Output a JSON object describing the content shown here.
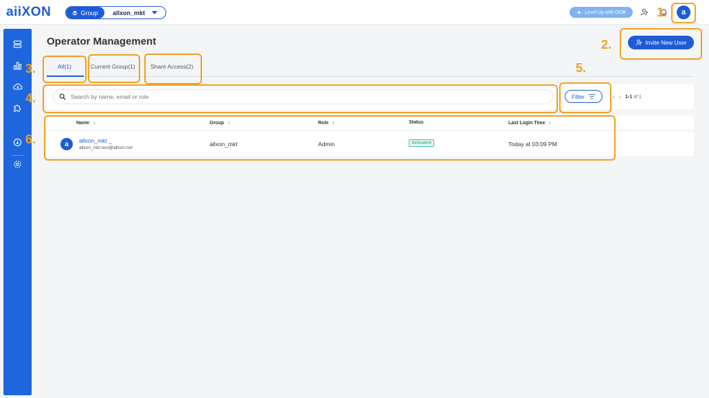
{
  "header": {
    "logo_text": "aiiXON",
    "group_label": "Group",
    "group_name": "allxon_mkt",
    "level_up_label": "Level Up with OOB",
    "avatar_letter": "a"
  },
  "sidebar": {
    "items": [
      {
        "icon": "server-icon"
      },
      {
        "icon": "bar-chart-icon"
      },
      {
        "icon": "cloud-upload-icon"
      },
      {
        "icon": "puzzle-icon"
      },
      {
        "icon": "download-circle-icon"
      },
      {
        "icon": "gear-icon"
      }
    ]
  },
  "page": {
    "title": "Operator Management",
    "invite_label": "Invite New User"
  },
  "tabs": [
    {
      "label": "All(1)",
      "active": true
    },
    {
      "label": "Current Group(1)",
      "active": false
    },
    {
      "label": "Share Access(2)",
      "active": false
    }
  ],
  "search": {
    "placeholder": "Search by name, email or role",
    "value": ""
  },
  "filter_label": "Filter",
  "pagination": {
    "range": "1-1",
    "of_text": "of 1"
  },
  "table": {
    "columns": [
      "Name",
      "Group",
      "Role",
      "Status",
      "Last Login Time"
    ],
    "rows": [
      {
        "avatar": "a",
        "name": "allxon_mkt _",
        "email": "allxon_mkt.test@allxon.net",
        "group": "allxon_mkt",
        "role": "Admin",
        "status": "Activated",
        "last_login": "Today at 03:09 PM"
      }
    ]
  },
  "annotations": [
    "1.",
    "2.",
    "3.",
    "4.",
    "5.",
    "6."
  ],
  "colors": {
    "brand": "#1e5bd8",
    "sidebar": "#1e66dd",
    "callout": "#f0a020",
    "status_active": "#1ea18a"
  }
}
